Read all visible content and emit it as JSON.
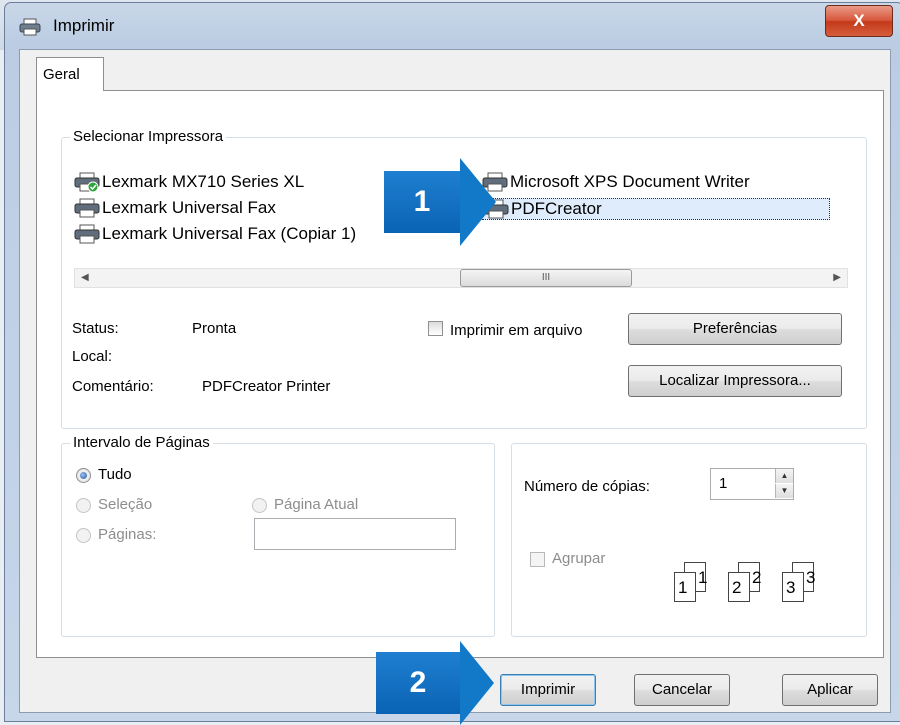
{
  "window": {
    "title": "Imprimir",
    "close_label": "X"
  },
  "tabs": [
    {
      "label": "Geral"
    }
  ],
  "printer_group": {
    "title": "Selecionar Impressora",
    "printers": [
      {
        "name": "Lexmark MX710 Series XL",
        "icon": "printer-default-icon"
      },
      {
        "name": "Lexmark Universal Fax",
        "icon": "printer-icon"
      },
      {
        "name": "Lexmark Universal Fax (Copiar 1)",
        "icon": "printer-icon"
      },
      {
        "name": "Microsoft XPS Document Writer",
        "icon": "printer-icon"
      },
      {
        "name": "PDFCreator",
        "icon": "printer-icon",
        "selected": true
      }
    ],
    "scrollbar_grip": "III",
    "status_label": "Status:",
    "status_value": "Pronta",
    "location_label": "Local:",
    "location_value": "",
    "comment_label": "Comentário:",
    "comment_value": "PDFCreator Printer",
    "print_to_file_label": "Imprimir em arquivo",
    "preferences_label": "Preferências",
    "find_printer_label": "Localizar Impressora..."
  },
  "range_group": {
    "title": "Intervalo de Páginas",
    "all_label": "Tudo",
    "selection_label": "Seleção",
    "current_page_label": "Página Atual",
    "pages_label": "Páginas:",
    "pages_value": ""
  },
  "copies_group": {
    "copies_label": "Número de cópias:",
    "copies_value": "1",
    "collate_label": "Agrupar",
    "collate_pages": [
      "1",
      "1",
      "2",
      "2",
      "3",
      "3"
    ]
  },
  "footer": {
    "print_label": "Imprimir",
    "cancel_label": "Cancelar",
    "apply_label": "Aplicar"
  },
  "callouts": [
    {
      "label": "1"
    },
    {
      "label": "2"
    }
  ],
  "colors": {
    "callout": "#0a63b5",
    "selection": "#dfecfb",
    "close": "#c33a1a"
  }
}
